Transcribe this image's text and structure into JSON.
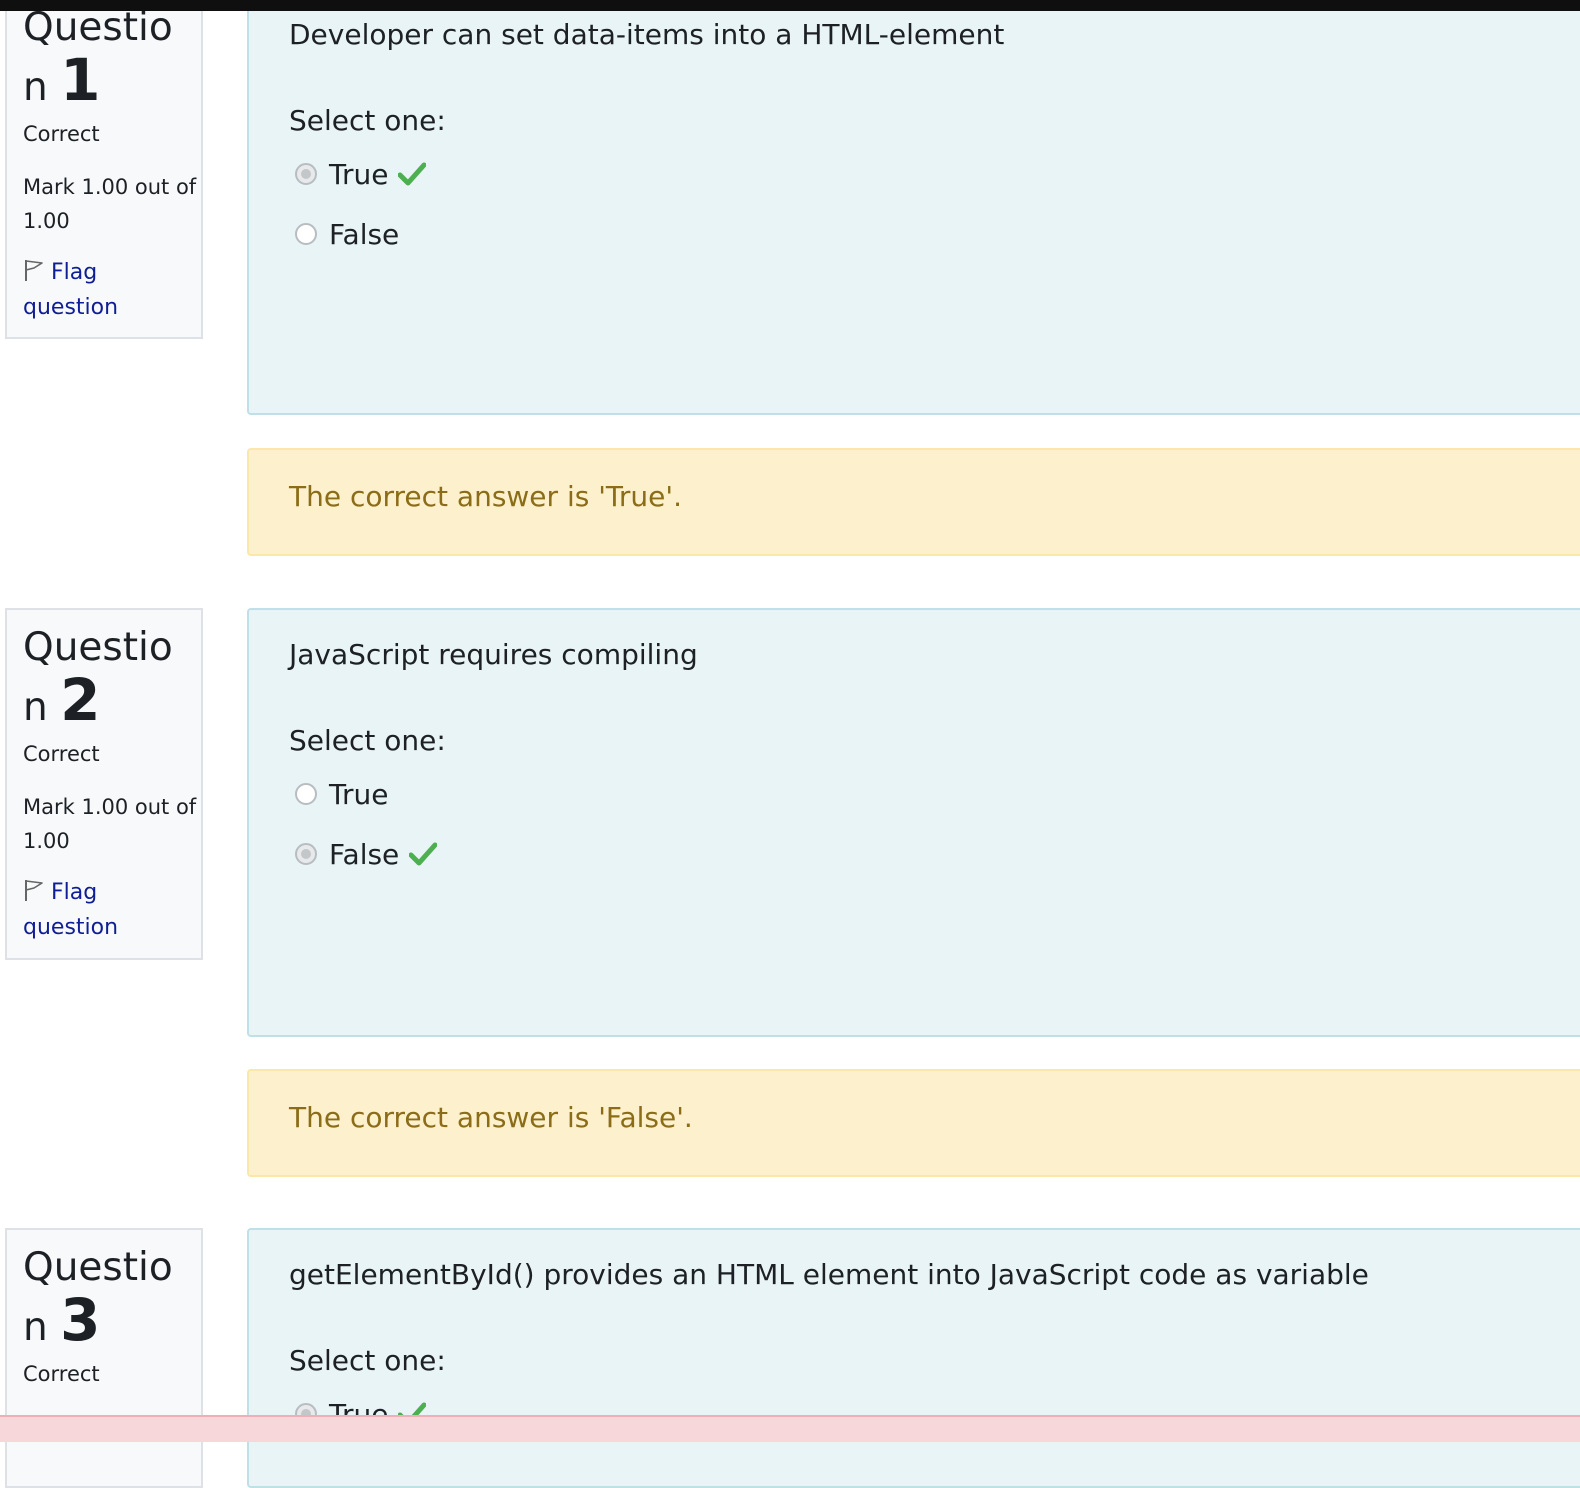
{
  "questions": [
    {
      "title_prefix": "Questio",
      "title_suffix": "n",
      "number": "1",
      "state": "Correct",
      "grade": "Mark 1.00 out of 1.00",
      "flag_label": "Flag question",
      "text": "Developer can set data-items into a HTML-element",
      "prompt": "Select one:",
      "answers": [
        {
          "label": "True",
          "selected": true,
          "correct": true
        },
        {
          "label": "False",
          "selected": false,
          "correct": false
        }
      ],
      "feedback": "The correct answer is 'True'."
    },
    {
      "title_prefix": "Questio",
      "title_suffix": "n",
      "number": "2",
      "state": "Correct",
      "grade": "Mark 1.00 out of 1.00",
      "flag_label": "Flag question",
      "text": "JavaScript requires compiling",
      "prompt": "Select one:",
      "answers": [
        {
          "label": "True",
          "selected": false,
          "correct": false
        },
        {
          "label": "False",
          "selected": true,
          "correct": true
        }
      ],
      "feedback": "The correct answer is 'False'."
    },
    {
      "title_prefix": "Questio",
      "title_suffix": "n",
      "number": "3",
      "state": "Correct",
      "text": "getElementById() provides an HTML element into JavaScript code as variable",
      "prompt": "Select one:",
      "answers": [
        {
          "label": "True",
          "selected": true,
          "correct": true
        }
      ]
    }
  ],
  "colors": {
    "formulation_bg": "#e9f4f7",
    "feedback_bg": "#fcf0cd",
    "feedback_text": "#8b6d18",
    "link": "#0f1e94",
    "correct_check": "#4caf50"
  },
  "icons": {
    "flag": "flag-icon",
    "correct": "check-icon"
  }
}
